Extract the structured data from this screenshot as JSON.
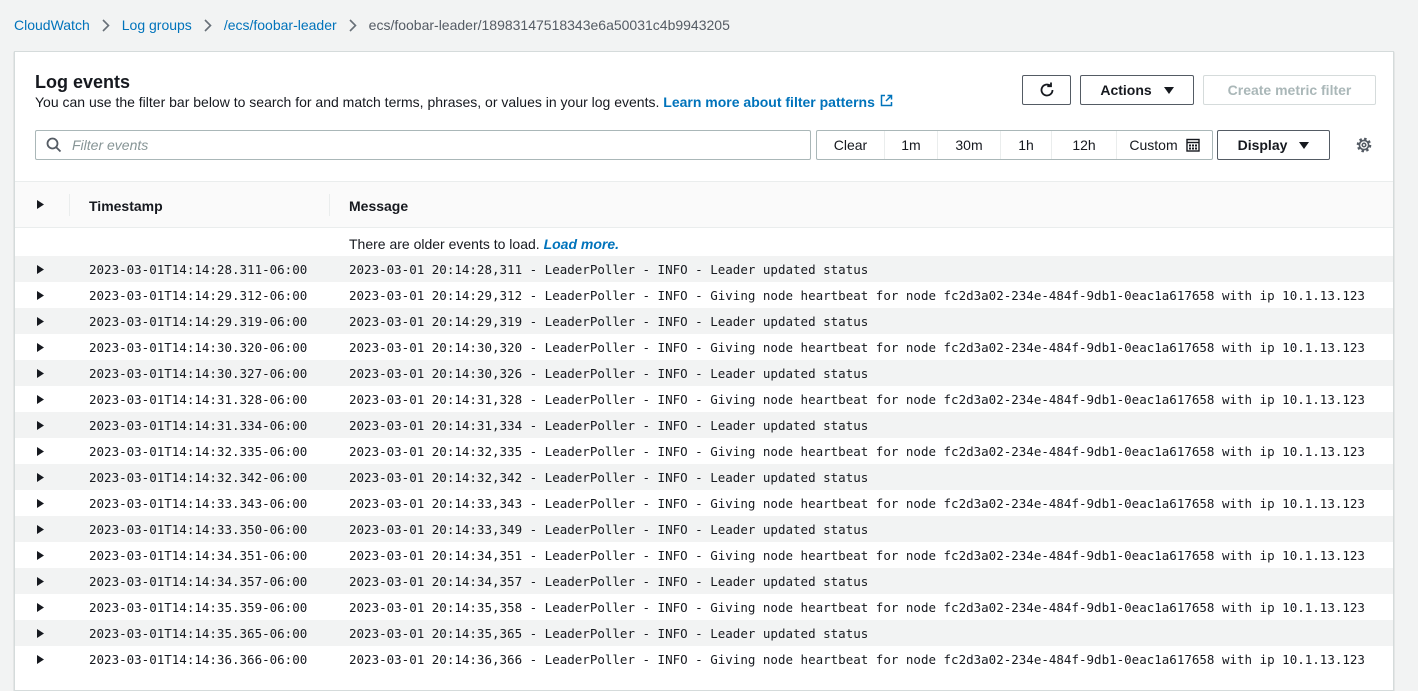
{
  "breadcrumb": {
    "items": [
      "CloudWatch",
      "Log groups",
      "/ecs/foobar-leader"
    ],
    "current": "ecs/foobar-leader/18983147518343e6a50031c4b9943205"
  },
  "panel": {
    "title": "Log events",
    "description": "You can use the filter bar below to search for and match terms, phrases, or values in your log events.",
    "learn_more": "Learn more about filter patterns"
  },
  "toolbar": {
    "actions_label": "Actions",
    "create_metric_filter_label": "Create metric filter",
    "display_label": "Display"
  },
  "filter": {
    "placeholder": "Filter events",
    "value": ""
  },
  "time_range": {
    "clear": "Clear",
    "m1": "1m",
    "m30": "30m",
    "h1": "1h",
    "h12": "12h",
    "custom": "Custom"
  },
  "table": {
    "columns": {
      "timestamp": "Timestamp",
      "message": "Message"
    },
    "older_events_text": "There are older events to load.",
    "load_more_label": "Load more.",
    "rows": [
      {
        "timestamp": "2023-03-01T14:14:28.311-06:00",
        "message": "2023-03-01 20:14:28,311 - LeaderPoller - INFO - Leader updated status"
      },
      {
        "timestamp": "2023-03-01T14:14:29.312-06:00",
        "message": "2023-03-01 20:14:29,312 - LeaderPoller - INFO - Giving node heartbeat for node fc2d3a02-234e-484f-9db1-0eac1a617658 with ip 10.1.13.123"
      },
      {
        "timestamp": "2023-03-01T14:14:29.319-06:00",
        "message": "2023-03-01 20:14:29,319 - LeaderPoller - INFO - Leader updated status"
      },
      {
        "timestamp": "2023-03-01T14:14:30.320-06:00",
        "message": "2023-03-01 20:14:30,320 - LeaderPoller - INFO - Giving node heartbeat for node fc2d3a02-234e-484f-9db1-0eac1a617658 with ip 10.1.13.123"
      },
      {
        "timestamp": "2023-03-01T14:14:30.327-06:00",
        "message": "2023-03-01 20:14:30,326 - LeaderPoller - INFO - Leader updated status"
      },
      {
        "timestamp": "2023-03-01T14:14:31.328-06:00",
        "message": "2023-03-01 20:14:31,328 - LeaderPoller - INFO - Giving node heartbeat for node fc2d3a02-234e-484f-9db1-0eac1a617658 with ip 10.1.13.123"
      },
      {
        "timestamp": "2023-03-01T14:14:31.334-06:00",
        "message": "2023-03-01 20:14:31,334 - LeaderPoller - INFO - Leader updated status"
      },
      {
        "timestamp": "2023-03-01T14:14:32.335-06:00",
        "message": "2023-03-01 20:14:32,335 - LeaderPoller - INFO - Giving node heartbeat for node fc2d3a02-234e-484f-9db1-0eac1a617658 with ip 10.1.13.123"
      },
      {
        "timestamp": "2023-03-01T14:14:32.342-06:00",
        "message": "2023-03-01 20:14:32,342 - LeaderPoller - INFO - Leader updated status"
      },
      {
        "timestamp": "2023-03-01T14:14:33.343-06:00",
        "message": "2023-03-01 20:14:33,343 - LeaderPoller - INFO - Giving node heartbeat for node fc2d3a02-234e-484f-9db1-0eac1a617658 with ip 10.1.13.123"
      },
      {
        "timestamp": "2023-03-01T14:14:33.350-06:00",
        "message": "2023-03-01 20:14:33,349 - LeaderPoller - INFO - Leader updated status"
      },
      {
        "timestamp": "2023-03-01T14:14:34.351-06:00",
        "message": "2023-03-01 20:14:34,351 - LeaderPoller - INFO - Giving node heartbeat for node fc2d3a02-234e-484f-9db1-0eac1a617658 with ip 10.1.13.123"
      },
      {
        "timestamp": "2023-03-01T14:14:34.357-06:00",
        "message": "2023-03-01 20:14:34,357 - LeaderPoller - INFO - Leader updated status"
      },
      {
        "timestamp": "2023-03-01T14:14:35.359-06:00",
        "message": "2023-03-01 20:14:35,358 - LeaderPoller - INFO - Giving node heartbeat for node fc2d3a02-234e-484f-9db1-0eac1a617658 with ip 10.1.13.123"
      },
      {
        "timestamp": "2023-03-01T14:14:35.365-06:00",
        "message": "2023-03-01 20:14:35,365 - LeaderPoller - INFO - Leader updated status"
      },
      {
        "timestamp": "2023-03-01T14:14:36.366-06:00",
        "message": "2023-03-01 20:14:36,366 - LeaderPoller - INFO - Giving node heartbeat for node fc2d3a02-234e-484f-9db1-0eac1a617658 with ip 10.1.13.123"
      }
    ]
  },
  "icons": {
    "breadcrumb_separator": "chevron-right-icon",
    "refresh": "refresh-icon",
    "external_link": "external-link-icon",
    "search": "search-icon",
    "calendar": "calendar-icon",
    "settings": "gear-icon",
    "row_expand": "caret-right-icon"
  },
  "colors": {
    "link": "#0073bb",
    "text": "#16191f",
    "disabled": "#aab7b8",
    "page_bg": "#f2f3f3",
    "row_alt_bg": "#f2f3f3"
  }
}
